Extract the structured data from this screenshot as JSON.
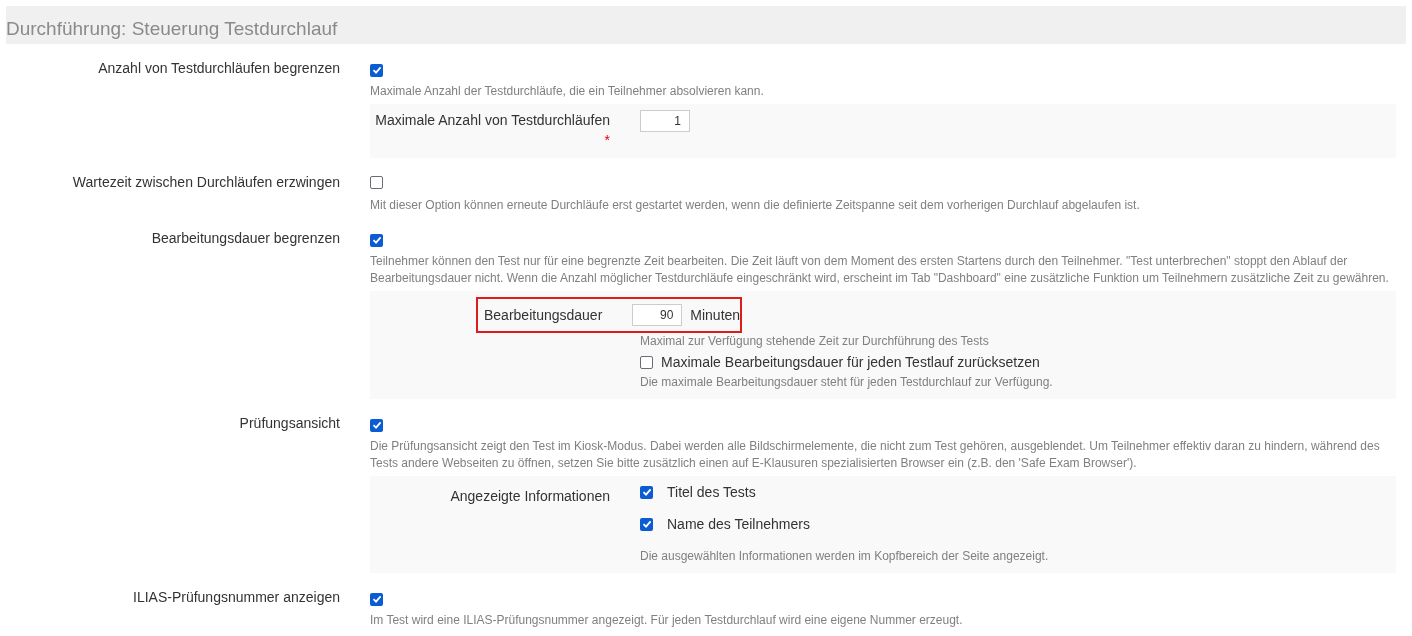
{
  "section_title": "Durchführung: Steuerung Testdurchlauf",
  "rows": [
    {
      "label": "Anzahl von Testdurchläufen begrenzen",
      "checked": true,
      "info": "Maximale Anzahl der Testdurchläufe, die ein Teilnehmer absolvieren kann.",
      "sub": {
        "kind": "number",
        "label": "Maximale Anzahl von Testdurchläufen",
        "required_mark": "*",
        "value": "1"
      }
    },
    {
      "label": "Wartezeit zwischen Durchläufen erzwingen",
      "checked": false,
      "info": "Mit dieser Option können erneute Durchläufe erst gestartet werden, wenn die definierte Zeitspanne seit dem vorherigen Durchlauf abgelaufen ist."
    },
    {
      "label": "Bearbeitungsdauer begrenzen",
      "checked": true,
      "info": "Teilnehmer können den Test nur für eine begrenzte Zeit bearbeiten. Die Zeit läuft von dem Moment des ersten Startens durch den Teilnehmer. \"Test unterbrechen\" stoppt den Ablauf der Bearbeitungsdauer nicht. Wenn die Anzahl möglicher Testdurchläufe eingeschränkt wird, erscheint im Tab \"Dashboard\" eine zusätzliche Funktion um Teilnehmern zusätzliche Zeit zu gewähren.",
      "sub": {
        "kind": "duration",
        "label": "Bearbeitungsdauer",
        "value": "90",
        "unit": "Minuten",
        "highlighted": true,
        "info": "Maximal zur Verfügung stehende Zeit zur Durchführung des Tests",
        "option": {
          "label": "Maximale Bearbeitungsdauer für jeden Testlauf zurücksetzen",
          "checked": false,
          "info": "Die maximale Bearbeitungsdauer steht für jeden Testdurchlauf zur Verfügung."
        }
      }
    },
    {
      "label": "Prüfungsansicht",
      "checked": true,
      "info": "Die Prüfungsansicht zeigt den Test im Kiosk-Modus. Dabei werden alle Bildschirmelemente, die nicht zum Test gehören, ausgeblendet. Um Teilnehmer effektiv daran zu hindern, während des Tests andere Webseiten zu öffnen, setzen Sie bitte zusätzlich einen auf E-Klausuren spezialisierten Browser ein (z.B. den 'Safe Exam Browser').",
      "sub": {
        "kind": "checklist",
        "label": "Angezeigte Informationen",
        "options": [
          {
            "label": "Titel des Tests",
            "checked": true
          },
          {
            "label": "Name des Teilnehmers",
            "checked": true
          }
        ],
        "info": "Die ausgewählten Informationen werden im Kopfbereich der Seite angezeigt."
      }
    },
    {
      "label": "ILIAS-Prüfungsnummer anzeigen",
      "checked": true,
      "info": "Im Test wird eine ILIAS-Prüfungsnummer angezeigt. Für jeden Testdurchlauf wird eine eigene Nummer erzeugt."
    }
  ]
}
